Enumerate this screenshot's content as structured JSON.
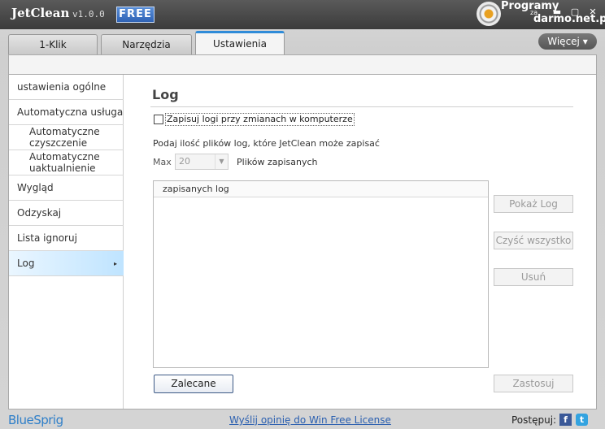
{
  "titlebar": {
    "app_name": "JetClean",
    "version": "v1.0.0",
    "badge": "FREE",
    "watermark_line1": "Programy",
    "watermark_za": "za",
    "watermark_line2": "darmo.net.pl",
    "minimize_glyph": "▬",
    "maximize_glyph": "▢",
    "close_glyph": "✕"
  },
  "tabs": [
    {
      "label": "1-Klik"
    },
    {
      "label": "Narzędzia"
    },
    {
      "label": "Ustawienia",
      "active": true
    }
  ],
  "more_button": {
    "label": "Więcej ▾"
  },
  "sidebar": {
    "items": [
      {
        "label": "ustawienia ogólne"
      },
      {
        "label": "Automatyczna usługa"
      },
      {
        "label": "Automatyczne czyszczenie"
      },
      {
        "label": "Automatyczne uaktualnienie"
      },
      {
        "label": "Wygląd"
      },
      {
        "label": "Odzyskaj"
      },
      {
        "label": "Lista ignoruj"
      },
      {
        "label": "Log",
        "active": true
      }
    ],
    "active_arrow": "▸"
  },
  "panel": {
    "title": "Log",
    "checkbox_label": "Zapisuj logi przy zmianach w komputerze",
    "checkbox_checked": false,
    "hint": "Podaj ilość plików log, które JetClean może zapisać",
    "max_label": "Max",
    "max_value": "20",
    "files_label": "Plików zapisanych",
    "list_header": "zapisanych log",
    "buttons": {
      "show_log": "Pokaż Log",
      "clear_all": "Czyść wszystko",
      "delete": "Usuń",
      "recommended": "Zalecane",
      "apply": "Zastosuj"
    }
  },
  "footer": {
    "brand": "BlueSprig",
    "feedback_link": "Wyślij opinię do Win Free License",
    "follow_label": "Postępuj:",
    "facebook": "f",
    "twitter": "t"
  },
  "colors": {
    "accent": "#2f8bd8",
    "facebook": "#3b5998",
    "twitter": "#33a3e0"
  }
}
